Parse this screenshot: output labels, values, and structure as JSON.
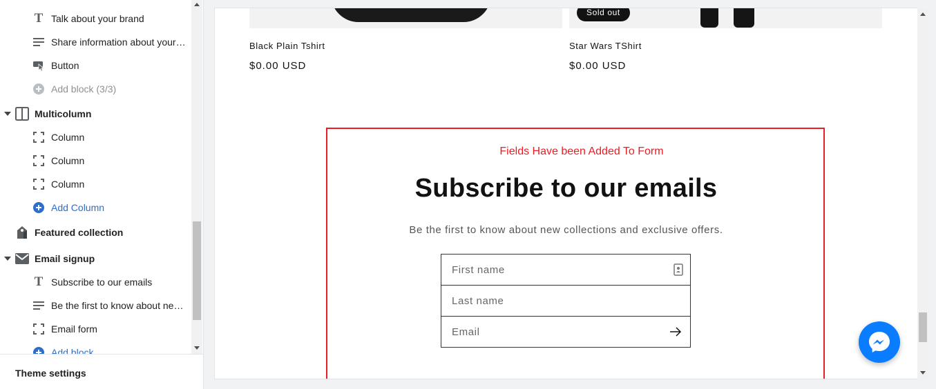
{
  "sidebar": {
    "items": [
      {
        "label": "Talk about your brand"
      },
      {
        "label": "Share information about your brand with your customers"
      },
      {
        "label": "Button"
      },
      {
        "label": "Add block (3/3)"
      },
      {
        "label": "Multicolumn"
      },
      {
        "label": "Column"
      },
      {
        "label": "Column"
      },
      {
        "label": "Column"
      },
      {
        "label": "Add Column"
      },
      {
        "label": "Featured collection"
      },
      {
        "label": "Email signup"
      },
      {
        "label": "Subscribe to our emails"
      },
      {
        "label": "Be the first to know about new collections and exclusive offers."
      },
      {
        "label": "Email form"
      },
      {
        "label": "Add block"
      }
    ],
    "footer_label": "Theme settings"
  },
  "preview": {
    "products": [
      {
        "title": "Black Plain Tshirt",
        "price": "$0.00 USD"
      },
      {
        "title": "Star Wars TShirt",
        "price": "$0.00 USD",
        "badge": "Sold out"
      }
    ],
    "annotation": "Fields Have been Added To Form",
    "signup": {
      "heading": "Subscribe to our emails",
      "subtext": "Be the first to know about new collections and exclusive offers.",
      "first_name_placeholder": "First name",
      "last_name_placeholder": "Last name",
      "email_placeholder": "Email"
    }
  },
  "colors": {
    "annotation_red": "#ec1c24",
    "link_blue": "#2c6ecb",
    "messenger_blue": "#0a7cff"
  }
}
